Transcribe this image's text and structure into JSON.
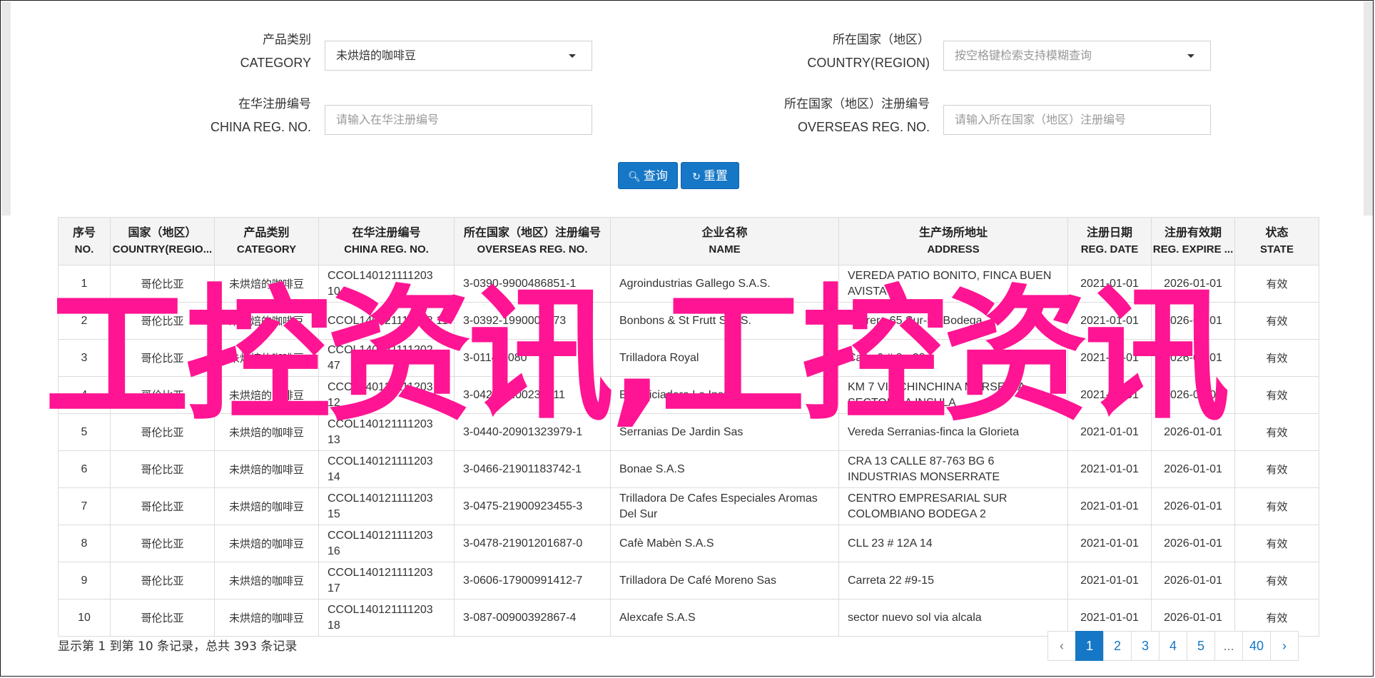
{
  "filters": {
    "category": {
      "label_cn": "产品类别",
      "label_en": "CATEGORY",
      "value": "未烘焙的咖啡豆"
    },
    "country": {
      "label_cn": "所在国家（地区）",
      "label_en": "COUNTRY(REGION)",
      "placeholder": "按空格键检索支持模糊查询"
    },
    "china_reg": {
      "label_cn": "在华注册编号",
      "label_en": "CHINA REG. NO.",
      "placeholder": "请输入在华注册编号"
    },
    "overseas_reg": {
      "label_cn": "所在国家（地区）注册编号",
      "label_en": "OVERSEAS REG. NO.",
      "placeholder": "请输入所在国家（地区）注册编号"
    }
  },
  "buttons": {
    "search": "查询",
    "reset": "重置"
  },
  "table": {
    "headers": [
      {
        "cn": "序号",
        "en": "NO."
      },
      {
        "cn": "国家（地区）",
        "en": "COUNTRY(REGIO..."
      },
      {
        "cn": "产品类别",
        "en": "CATEGORY"
      },
      {
        "cn": "在华注册编号",
        "en": "CHINA REG. NO."
      },
      {
        "cn": "所在国家（地区）注册编号",
        "en": "OVERSEAS REG. NO."
      },
      {
        "cn": "企业名称",
        "en": "NAME"
      },
      {
        "cn": "生产场所地址",
        "en": "ADDRESS"
      },
      {
        "cn": "注册日期",
        "en": "REG. DATE"
      },
      {
        "cn": "注册有效期",
        "en": "REG. EXPIRE ..."
      },
      {
        "cn": "状态",
        "en": "STATE"
      }
    ],
    "rows": [
      [
        "1",
        "哥伦比亚",
        "未烘焙的咖啡豆",
        "CCOL140121111203 10",
        "3-0390-9900486851-1",
        "Agroindustrias Gallego S.A.S.",
        "VEREDA PATIO BONITO, FINCA BUEN AVISTA",
        "2021-01-01",
        "2026-01-01",
        "有效"
      ],
      [
        "2",
        "哥伦比亚",
        "未烘焙的咖啡豆",
        "CCOL140121111203 11",
        "3-0392-1990005973",
        "Bonbons & St Frutt S.A.S.",
        "Carrera 65 Sur-54 Bodega",
        "2021-01-01",
        "2026-01-01",
        "有效"
      ],
      [
        "3",
        "哥伦比亚",
        "未烘焙的咖啡豆",
        "CCOL140121111202 47",
        "3-0114-0080",
        "Trilladora Royal",
        "Calle 6 # 8 - 28",
        "2021-01-01",
        "2026-01-01",
        "有效"
      ],
      [
        "4",
        "哥伦比亚",
        "未烘焙的咖啡豆",
        "CCOL140121111203 12",
        "3-0428-2100238611",
        "Beneficiadero La Insula",
        "KM 7 VIA CHINCHINA MARSELLA, SECTOR LA INSULA",
        "2021-01-01",
        "2026-01-01",
        "有效"
      ],
      [
        "5",
        "哥伦比亚",
        "未烘焙的咖啡豆",
        "CCOL140121111203 13",
        "3-0440-20901323979-1",
        "Serranias De Jardin Sas",
        "Vereda Serranias-finca la Glorieta",
        "2021-01-01",
        "2026-01-01",
        "有效"
      ],
      [
        "6",
        "哥伦比亚",
        "未烘焙的咖啡豆",
        "CCOL140121111203 14",
        "3-0466-21901183742-1",
        "Bonae S.A.S",
        "CRA 13 CALLE 87-763 BG 6 INDUSTRIAS MONSERRATE",
        "2021-01-01",
        "2026-01-01",
        "有效"
      ],
      [
        "7",
        "哥伦比亚",
        "未烘焙的咖啡豆",
        "CCOL140121111203 15",
        "3-0475-21900923455-3",
        "Trilladora De Cafes Especiales Aromas Del Sur",
        "CENTRO EMPRESARIAL SUR COLOMBIANO BODEGA 2",
        "2021-01-01",
        "2026-01-01",
        "有效"
      ],
      [
        "8",
        "哥伦比亚",
        "未烘焙的咖啡豆",
        "CCOL140121111203 16",
        "3-0478-21901201687-0",
        "Cafè Mabèn S.A.S",
        "CLL 23 # 12A 14",
        "2021-01-01",
        "2026-01-01",
        "有效"
      ],
      [
        "9",
        "哥伦比亚",
        "未烘焙的咖啡豆",
        "CCOL140121111203 17",
        "3-0606-17900991412-7",
        "Trilladora De Café Moreno Sas",
        "Carreta 22 #9-15",
        "2021-01-01",
        "2026-01-01",
        "有效"
      ],
      [
        "10",
        "哥伦比亚",
        "未烘焙的咖啡豆",
        "CCOL140121111203 18",
        "3-087-00900392867-4",
        "Alexcafe S.A.S",
        "sector nuevo sol via alcala",
        "2021-01-01",
        "2026-01-01",
        "有效"
      ]
    ]
  },
  "summary": "显示第 1 到第 10 条记录，总共 393 条记录",
  "pagination": {
    "prev": "‹",
    "pages": [
      "1",
      "2",
      "3",
      "4",
      "5",
      "...",
      "40"
    ],
    "next": "›",
    "active": "1"
  },
  "watermark": "工控资讯,工控资讯",
  "colors": {
    "primary": "#1577c6",
    "watermark": "#ff1493"
  }
}
